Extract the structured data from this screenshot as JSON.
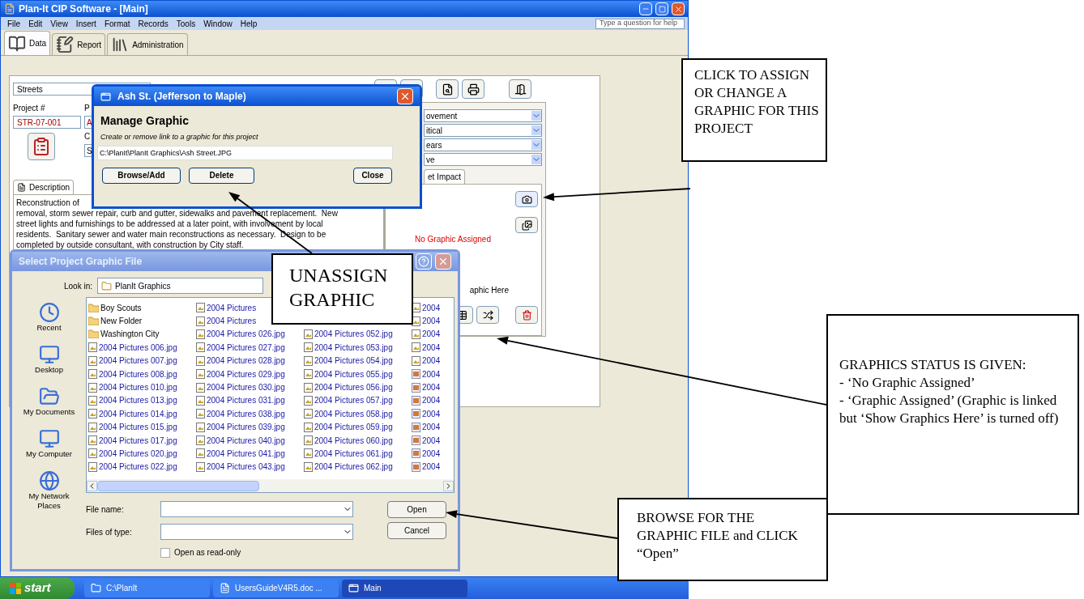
{
  "window": {
    "title": "Plan-It CIP Software - [Main]",
    "help_placeholder": "Type a question for help"
  },
  "menu": [
    "File",
    "Edit",
    "View",
    "Insert",
    "Format",
    "Records",
    "Tools",
    "Window",
    "Help"
  ],
  "tabs": [
    {
      "label": "Data",
      "selected": true
    },
    {
      "label": "Report",
      "selected": false
    },
    {
      "label": "Administration",
      "selected": false
    }
  ],
  "category": "Streets",
  "project": {
    "number_label": "Project #",
    "number": "STR-07-001",
    "label_2": "P",
    "value_2": "A",
    "label_3": "C",
    "value_3": "S"
  },
  "description_tab": {
    "label": "Description",
    "selected": true
  },
  "description_lines": [
    "Reconstruction of",
    "removal, storm sewer repair, curb and gutter, sidewalks and pavement replacement.  New",
    "street lights and furnishings to be addressed at a later point, with involvement by local",
    "residents.  Sanitary sewer and water main reconstructions as necessary.  Design to be",
    "completed by outside consultant, with construction by City staff."
  ],
  "dropdowns": [
    "ovement",
    "itical",
    "ears",
    "ve"
  ],
  "impact_tab": "et Impact",
  "graphic_status": "No Graphic Assigned",
  "show_graphic_label": "aphic Here",
  "manage_dialog": {
    "title": "Ash St. (Jefferson to Maple)",
    "heading": "Manage Graphic",
    "subtitle": "Create or remove link to a graphic for this project",
    "path": "C:\\PlanIt\\PlanIt Graphics\\Ash Street.JPG",
    "buttons": [
      "Browse/Add",
      "Delete",
      "Close"
    ]
  },
  "file_dialog": {
    "title": "Select Project Graphic File",
    "look_in_label": "Look in:",
    "look_in": "PlanIt Graphics",
    "places": [
      "Recent",
      "Desktop",
      "My Documents",
      "My Computer",
      "My Network Places"
    ],
    "columns": [
      [
        {
          "name": "Boy Scouts",
          "kind": "folder"
        },
        {
          "name": "New Folder",
          "kind": "folder"
        },
        {
          "name": "Washington City",
          "kind": "folder"
        },
        {
          "name": "2004 Pictures 006.jpg",
          "kind": "jpg"
        },
        {
          "name": "2004 Pictures 007.jpg",
          "kind": "jpg"
        },
        {
          "name": "2004 Pictures 008.jpg",
          "kind": "jpg"
        },
        {
          "name": "2004 Pictures 010.jpg",
          "kind": "jpg"
        },
        {
          "name": "2004 Pictures 013.jpg",
          "kind": "jpg"
        },
        {
          "name": "2004 Pictures 014.jpg",
          "kind": "jpg"
        },
        {
          "name": "2004 Pictures 015.jpg",
          "kind": "jpg"
        },
        {
          "name": "2004 Pictures 017.jpg",
          "kind": "jpg"
        },
        {
          "name": "2004 Pictures 020.jpg",
          "kind": "jpg"
        },
        {
          "name": "2004 Pictures 022.jpg",
          "kind": "jpg"
        }
      ],
      [
        {
          "name": "2004 Pictures",
          "kind": "jpg"
        },
        {
          "name": "2004 Pictures",
          "kind": "jpg"
        },
        {
          "name": "2004 Pictures 026.jpg",
          "kind": "jpg"
        },
        {
          "name": "2004 Pictures 027.jpg",
          "kind": "jpg"
        },
        {
          "name": "2004 Pictures 028.jpg",
          "kind": "jpg"
        },
        {
          "name": "2004 Pictures 029.jpg",
          "kind": "jpg"
        },
        {
          "name": "2004 Pictures 030.jpg",
          "kind": "jpg"
        },
        {
          "name": "2004 Pictures 031.jpg",
          "kind": "jpg"
        },
        {
          "name": "2004 Pictures 038.jpg",
          "kind": "jpg"
        },
        {
          "name": "2004 Pictures 039.jpg",
          "kind": "jpg"
        },
        {
          "name": "2004 Pictures 040.jpg",
          "kind": "jpg"
        },
        {
          "name": "2004 Pictures 041.jpg",
          "kind": "jpg"
        },
        {
          "name": "2004 Pictures 043.jpg",
          "kind": "jpg"
        }
      ],
      [
        null,
        null,
        {
          "name": "2004 Pictures 052.jpg",
          "kind": "jpg"
        },
        {
          "name": "2004 Pictures 053.jpg",
          "kind": "jpg"
        },
        {
          "name": "2004 Pictures 054.jpg",
          "kind": "jpg"
        },
        {
          "name": "2004 Pictures 055.jpg",
          "kind": "jpg"
        },
        {
          "name": "2004 Pictures 056.jpg",
          "kind": "jpg"
        },
        {
          "name": "2004 Pictures 057.jpg",
          "kind": "jpg"
        },
        {
          "name": "2004 Pictures 058.jpg",
          "kind": "jpg"
        },
        {
          "name": "2004 Pictures 059.jpg",
          "kind": "jpg"
        },
        {
          "name": "2004 Pictures 060.jpg",
          "kind": "jpg"
        },
        {
          "name": "2004 Pictures 061.jpg",
          "kind": "jpg"
        },
        {
          "name": "2004 Pictures 062.jpg",
          "kind": "jpg"
        }
      ],
      [
        {
          "name": "2004",
          "kind": "jpg"
        },
        {
          "name": "2004",
          "kind": "jpg"
        },
        {
          "name": "2004",
          "kind": "jpg"
        },
        {
          "name": "2004",
          "kind": "jpg"
        },
        {
          "name": "2004",
          "kind": "jpg"
        },
        {
          "name": "2004",
          "kind": "image"
        },
        {
          "name": "2004",
          "kind": "image"
        },
        {
          "name": "2004",
          "kind": "image"
        },
        {
          "name": "2004",
          "kind": "image"
        },
        {
          "name": "2004",
          "kind": "image"
        },
        {
          "name": "2004",
          "kind": "image"
        },
        {
          "name": "2004",
          "kind": "image"
        },
        {
          "name": "2004",
          "kind": "image"
        }
      ]
    ],
    "file_name_label": "File name:",
    "files_of_type_label": "Files of type:",
    "readonly": {
      "label": "Open as read-only",
      "checked": false
    },
    "buttons": [
      "Open",
      "Cancel"
    ]
  },
  "taskbar": {
    "start": "start",
    "items": [
      {
        "label": "C:\\PlanIt",
        "kind": "folder",
        "selected": false
      },
      {
        "label": "UsersGuideV4R5.doc ...",
        "kind": "document",
        "selected": false
      },
      {
        "label": "Main",
        "kind": "window",
        "selected": true
      }
    ]
  },
  "callouts": [
    {
      "lines": [
        "CLICK TO ASSIGN OR CHANGE A GRAPHIC FOR THIS PROJECT"
      ]
    },
    {
      "lines": [
        "UNASSIGN GRAPHIC"
      ]
    },
    {
      "lines": [
        "GRAPHICS STATUS IS GIVEN:",
        "- ‘No Graphic Assigned’",
        "- ‘Graphic Assigned’ (Graphic is linked but ‘Show Graphics Here’ is turned off)"
      ]
    },
    {
      "lines": [
        "BROWSE FOR THE GRAPHIC FILE and CLICK “Open”"
      ]
    }
  ]
}
